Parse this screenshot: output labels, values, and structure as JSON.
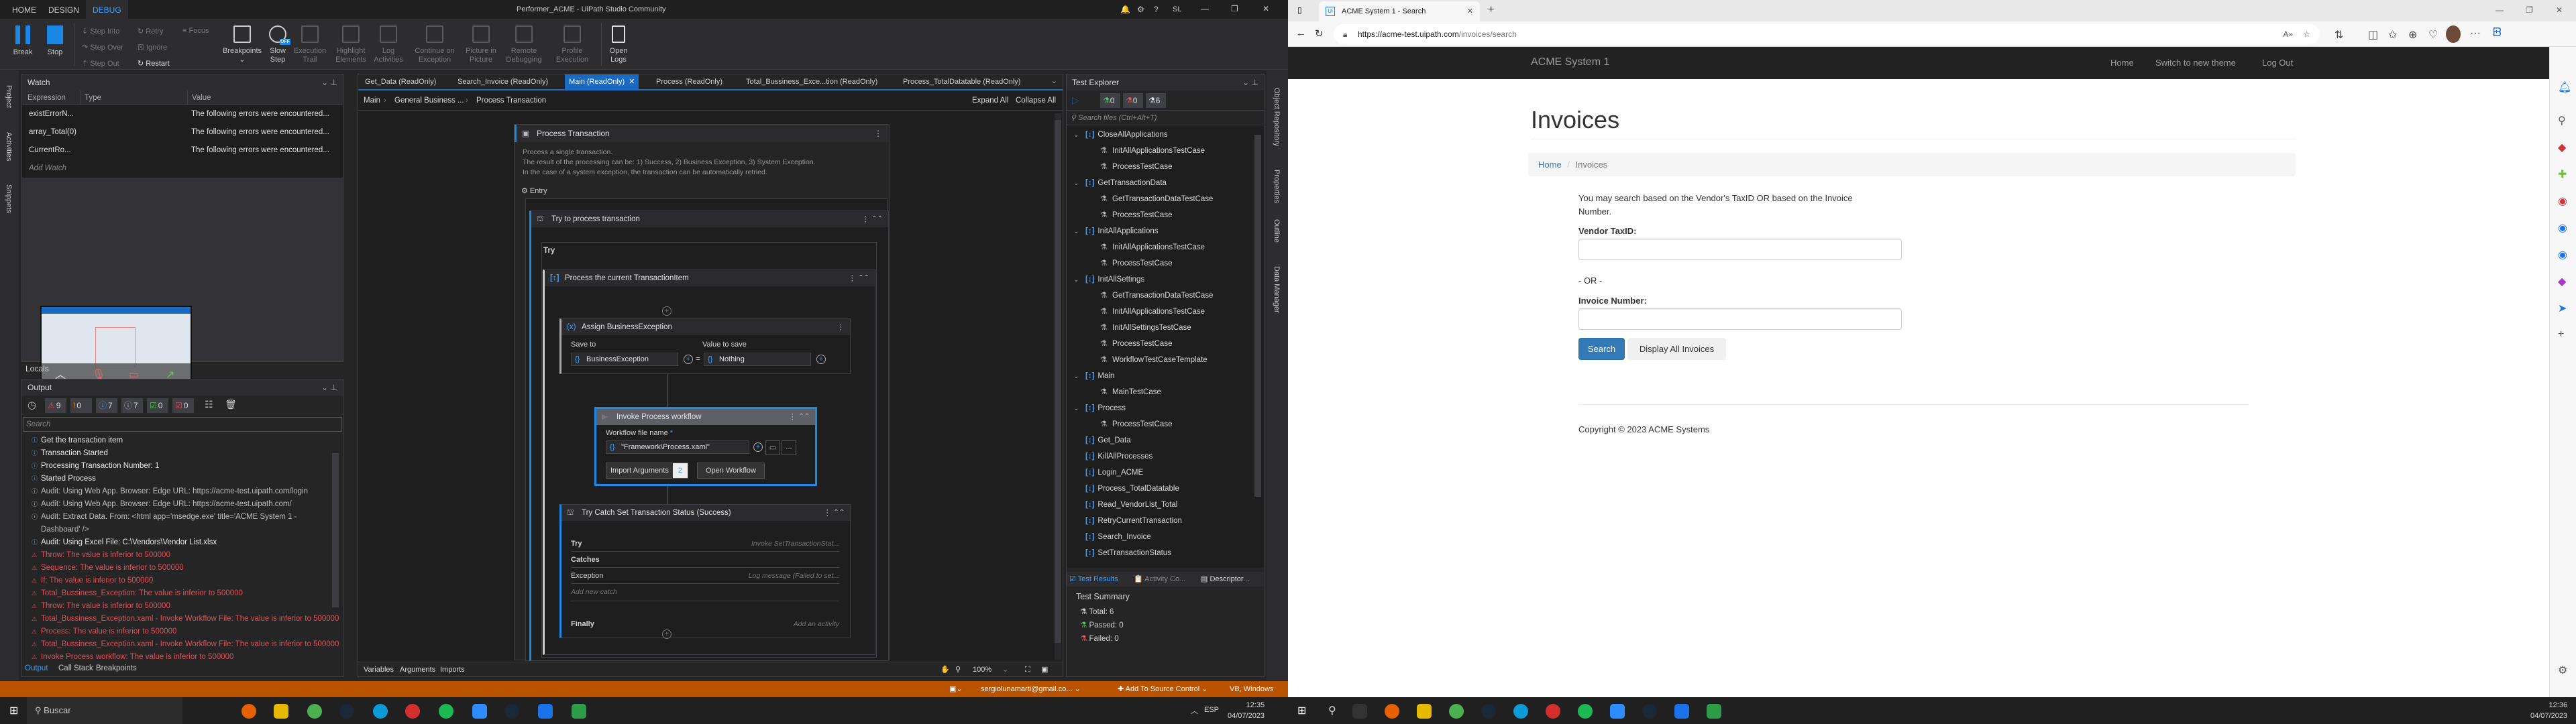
{
  "studio": {
    "title": "Performer_ACME - UiPath Studio Community",
    "user_initials": "SL",
    "ribbon_tabs": [
      "HOME",
      "DESIGN",
      "DEBUG"
    ],
    "active_ribbon_tab": "DEBUG",
    "ribbon": {
      "break": "Break",
      "stop": "Stop",
      "step_into": "Step Into",
      "step_over": "Step Over",
      "step_out": "Step Out",
      "retry": "Retry",
      "ignore": "Ignore",
      "restart": "Restart",
      "focus": "Focus",
      "breakpoints": "Breakpoints",
      "slow_step": "Slow Step",
      "execution_trail": "Execution Trail",
      "highlight_elements": "Highlight Elements",
      "log_activities": "Log Activities",
      "continue_on_exception": "Continue on Exception",
      "picture_in_picture": "Picture in Picture",
      "remote_debugging": "Remote Debugging",
      "profile_execution": "Profile Execution",
      "open_logs": "Open Logs",
      "slow_step_badge": "OFF"
    },
    "left_strip": [
      "Project",
      "Activities",
      "Snippets"
    ],
    "watch": {
      "title": "Watch",
      "columns": [
        "Expression",
        "Type",
        "Value"
      ],
      "rows": [
        {
          "expression": "existErrorN...",
          "type": "",
          "value": "The following errors were encountered..."
        },
        {
          "expression": "array_Total(0)",
          "type": "",
          "value": "The following errors were encountered..."
        },
        {
          "expression": "CurrentRo...",
          "type": "",
          "value": "The following errors were encountered..."
        }
      ],
      "add_watch": "Add Watch"
    },
    "locals_label": "Locals",
    "output": {
      "title": "Output",
      "filters": [
        {
          "kind": "errors",
          "count": "9",
          "color": "#e0505a"
        },
        {
          "kind": "warnings",
          "count": "0",
          "color": "#e8900c"
        },
        {
          "kind": "info",
          "count": "7",
          "color": "#3ba0ff"
        },
        {
          "kind": "trace",
          "count": "7",
          "color": "#aaaaaa"
        },
        {
          "kind": "passed",
          "count": "0",
          "color": "#5cc35c"
        },
        {
          "kind": "failed",
          "count": "0",
          "color": "#e0505a"
        }
      ],
      "search_placeholder": "Search",
      "lines": [
        {
          "level": "info",
          "text": "Get the transaction item"
        },
        {
          "level": "info",
          "text": "Transaction Started"
        },
        {
          "level": "info",
          "text": "Processing Transaction Number: 1"
        },
        {
          "level": "info",
          "text": "Started Process"
        },
        {
          "level": "trace",
          "text": "Audit: Using Web App. Browser: Edge URL: https://acme-test.uipath.com/login"
        },
        {
          "level": "trace",
          "text": "Audit: Using Web App. Browser: Edge URL: https://acme-test.uipath.com/"
        },
        {
          "level": "trace",
          "text": "Audit: Extract Data. From: <html app='msedge.exe' title='ACME System 1 -"
        },
        {
          "level": "cont",
          "text": "Dashboard' />"
        },
        {
          "level": "info",
          "text": "Audit: Using Excel File: C:\\Vendors\\Vendor List.xlsx"
        },
        {
          "level": "error",
          "text": "Throw: The value is inferior to 500000"
        },
        {
          "level": "error",
          "text": "Sequence: The value is inferior to 500000"
        },
        {
          "level": "error",
          "text": "If: The value is inferior to 500000"
        },
        {
          "level": "error",
          "text": "Total_Bussiness_Exception: The value is inferior to 500000"
        },
        {
          "level": "error",
          "text": "Throw: The value is inferior to 500000"
        },
        {
          "level": "error",
          "text": "Total_Bussiness_Exception.xaml - Invoke Workflow File: The value is inferior to 500000"
        },
        {
          "level": "error",
          "text": "Process: The value is inferior to 500000"
        },
        {
          "level": "error",
          "text": "Total_Bussiness_Exception.xaml - Invoke Workflow File: The value is inferior to 500000"
        },
        {
          "level": "error",
          "text": "Invoke Process workflow: The value is inferior to 500000"
        }
      ],
      "tabs": [
        "Output",
        "Call Stack",
        "Breakpoints"
      ]
    },
    "designer": {
      "tabs": [
        "Get_Data (ReadOnly)",
        "Search_Invoice (ReadOnly)",
        "Main (ReadOnly)",
        "Process (ReadOnly)",
        "Total_Bussiness_Exce...tion (ReadOnly)",
        "Process_TotalDatatable (ReadOnly)"
      ],
      "active_tab": "Main (ReadOnly)",
      "breadcrumb": [
        "Main",
        "General Business ...",
        "Process Transaction"
      ],
      "expand_all": "Expand All",
      "collapse_all": "Collapse All",
      "state_title": "Process Transaction",
      "state_description": [
        "Process a single transaction.",
        "The result of the processing can be: 1) Success, 2) Business Exception, 3) System Exception.",
        "In the case of a system exception, the transaction can be automatically retried."
      ],
      "entry_label": "Entry",
      "try_title": "Try to process transaction",
      "try_label": "Try",
      "sequence_title": "Process the current TransactionItem",
      "assign": {
        "title": "Assign BusinessException",
        "save_to_label": "Save to",
        "save_to_value": "BusinessException",
        "value_label": "Value to save",
        "value": "Nothing",
        "equals": "="
      },
      "invoke": {
        "title": "Invoke Process workflow",
        "file_label": "Workflow file name",
        "required_mark": "*",
        "file_value": "\"Framework\\Process.xaml\"",
        "import_arguments": "Import Arguments",
        "argument_count": "2",
        "open_workflow": "Open Workflow",
        "more": "..."
      },
      "try_catch": {
        "title": "Try Catch Set Transaction Status (Success)",
        "try_label": "Try",
        "try_value": "Invoke SetTransactionStat...",
        "catches_label": "Catches",
        "exception_label": "Exception",
        "exception_value": "Log message (Failed to set...",
        "add_catch": "Add new catch",
        "finally_label": "Finally",
        "finally_value": "Add an activity"
      },
      "bottom_tabs": [
        "Variables",
        "Arguments",
        "Imports"
      ],
      "zoom": "100%"
    },
    "test_explorer": {
      "title": "Test Explorer",
      "counts": {
        "passed": "0",
        "failed": "0",
        "total": "6"
      },
      "search_placeholder": "Search files (Ctrl+Alt+T)",
      "tree": [
        {
          "label": "CloseAllApplications",
          "kind": "file",
          "expanded": true
        },
        {
          "label": "InitAllApplicationsTestCase",
          "kind": "test"
        },
        {
          "label": "ProcessTestCase",
          "kind": "test"
        },
        {
          "label": "GetTransactionData",
          "kind": "file",
          "expanded": true
        },
        {
          "label": "GetTransactionDataTestCase",
          "kind": "test"
        },
        {
          "label": "ProcessTestCase",
          "kind": "test"
        },
        {
          "label": "InitAllApplications",
          "kind": "file",
          "expanded": true
        },
        {
          "label": "InitAllApplicationsTestCase",
          "kind": "test"
        },
        {
          "label": "ProcessTestCase",
          "kind": "test"
        },
        {
          "label": "InitAllSettings",
          "kind": "file",
          "expanded": true
        },
        {
          "label": "GetTransactionDataTestCase",
          "kind": "test"
        },
        {
          "label": "InitAllApplicationsTestCase",
          "kind": "test"
        },
        {
          "label": "InitAllSettingsTestCase",
          "kind": "test"
        },
        {
          "label": "ProcessTestCase",
          "kind": "test"
        },
        {
          "label": "WorkflowTestCaseTemplate",
          "kind": "test"
        },
        {
          "label": "Main",
          "kind": "file",
          "expanded": true
        },
        {
          "label": "MainTestCase",
          "kind": "test"
        },
        {
          "label": "Process",
          "kind": "file",
          "expanded": true
        },
        {
          "label": "ProcessTestCase",
          "kind": "test"
        },
        {
          "label": "Get_Data",
          "kind": "file"
        },
        {
          "label": "KillAllProcesses",
          "kind": "file"
        },
        {
          "label": "Login_ACME",
          "kind": "file"
        },
        {
          "label": "Process_TotalDatatable",
          "kind": "file"
        },
        {
          "label": "Read_VendorList_Total",
          "kind": "file"
        },
        {
          "label": "RetryCurrentTransaction",
          "kind": "file"
        },
        {
          "label": "Search_Invoice",
          "kind": "file"
        },
        {
          "label": "SetTransactionStatus",
          "kind": "file"
        }
      ],
      "bottom_tabs": [
        "Test Results",
        "Activity Co...",
        "Descriptor..."
      ],
      "summary_title": "Test Summary",
      "summary": [
        "Total: 6",
        "Passed: 0",
        "Failed: 0"
      ]
    },
    "right_strip": [
      "Object Repository",
      "Properties",
      "Outline",
      "Data Manager"
    ],
    "status_bar": {
      "account": "sergiolunamarti@gmail.co...",
      "source_control": "Add To Source Control",
      "language": "VB, Windows",
      "color": "#b95300"
    }
  },
  "taskbar_left": {
    "search": "Buscar",
    "lang": "ESP",
    "time": "12:35",
    "date": "04/07/2023"
  },
  "browser": {
    "tab_title": "ACME System 1 - Search",
    "url_host": "https://acme-test.uipath.com",
    "url_path": "/invoices/search",
    "brand": "ACME System 1",
    "nav": [
      "Home",
      "Switch to new theme",
      "Log Out"
    ],
    "heading": "Invoices",
    "breadcrumb": [
      "Home",
      "Invoices"
    ],
    "intro": "You may search based on the Vendor's TaxID OR based on the Invoice Number.",
    "vendor_label": "Vendor TaxID:",
    "vendor_value": "",
    "or_text": "- OR -",
    "invoice_label": "Invoice Number:",
    "invoice_value": "",
    "search_button": "Search",
    "display_all_button": "Display All Invoices",
    "footer": "Copyright © 2023 ACME Systems",
    "primary_color": "#337ab7"
  },
  "taskbar_right": {
    "time": "12:36",
    "date": "04/07/2023"
  }
}
